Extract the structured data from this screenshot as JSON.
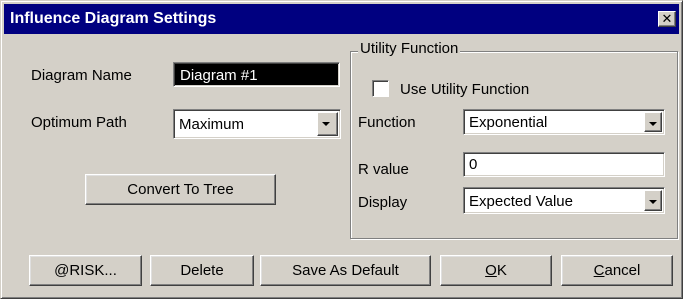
{
  "window": {
    "title": "Influence Diagram Settings",
    "close_glyph": "✕"
  },
  "form": {
    "diagram_name_label": "Diagram Name",
    "diagram_name_value": "Diagram #1",
    "optimum_path_label": "Optimum Path",
    "optimum_path_value": "Maximum",
    "convert_button": "Convert To Tree"
  },
  "utility": {
    "group_label": "Utility Function",
    "use_checkbox_label": "Use Utility Function",
    "use_checked": false,
    "function_label": "Function",
    "function_value": "Exponential",
    "r_value_label": "R value",
    "r_value": "0",
    "display_label": "Display",
    "display_value": "Expected Value"
  },
  "buttons": {
    "risk": "@RISK...",
    "delete": "Delete",
    "save_default": "Save As Default",
    "ok_mnemonic": "O",
    "ok_rest": "K",
    "cancel_mnemonic": "C",
    "cancel_rest": "ancel"
  }
}
